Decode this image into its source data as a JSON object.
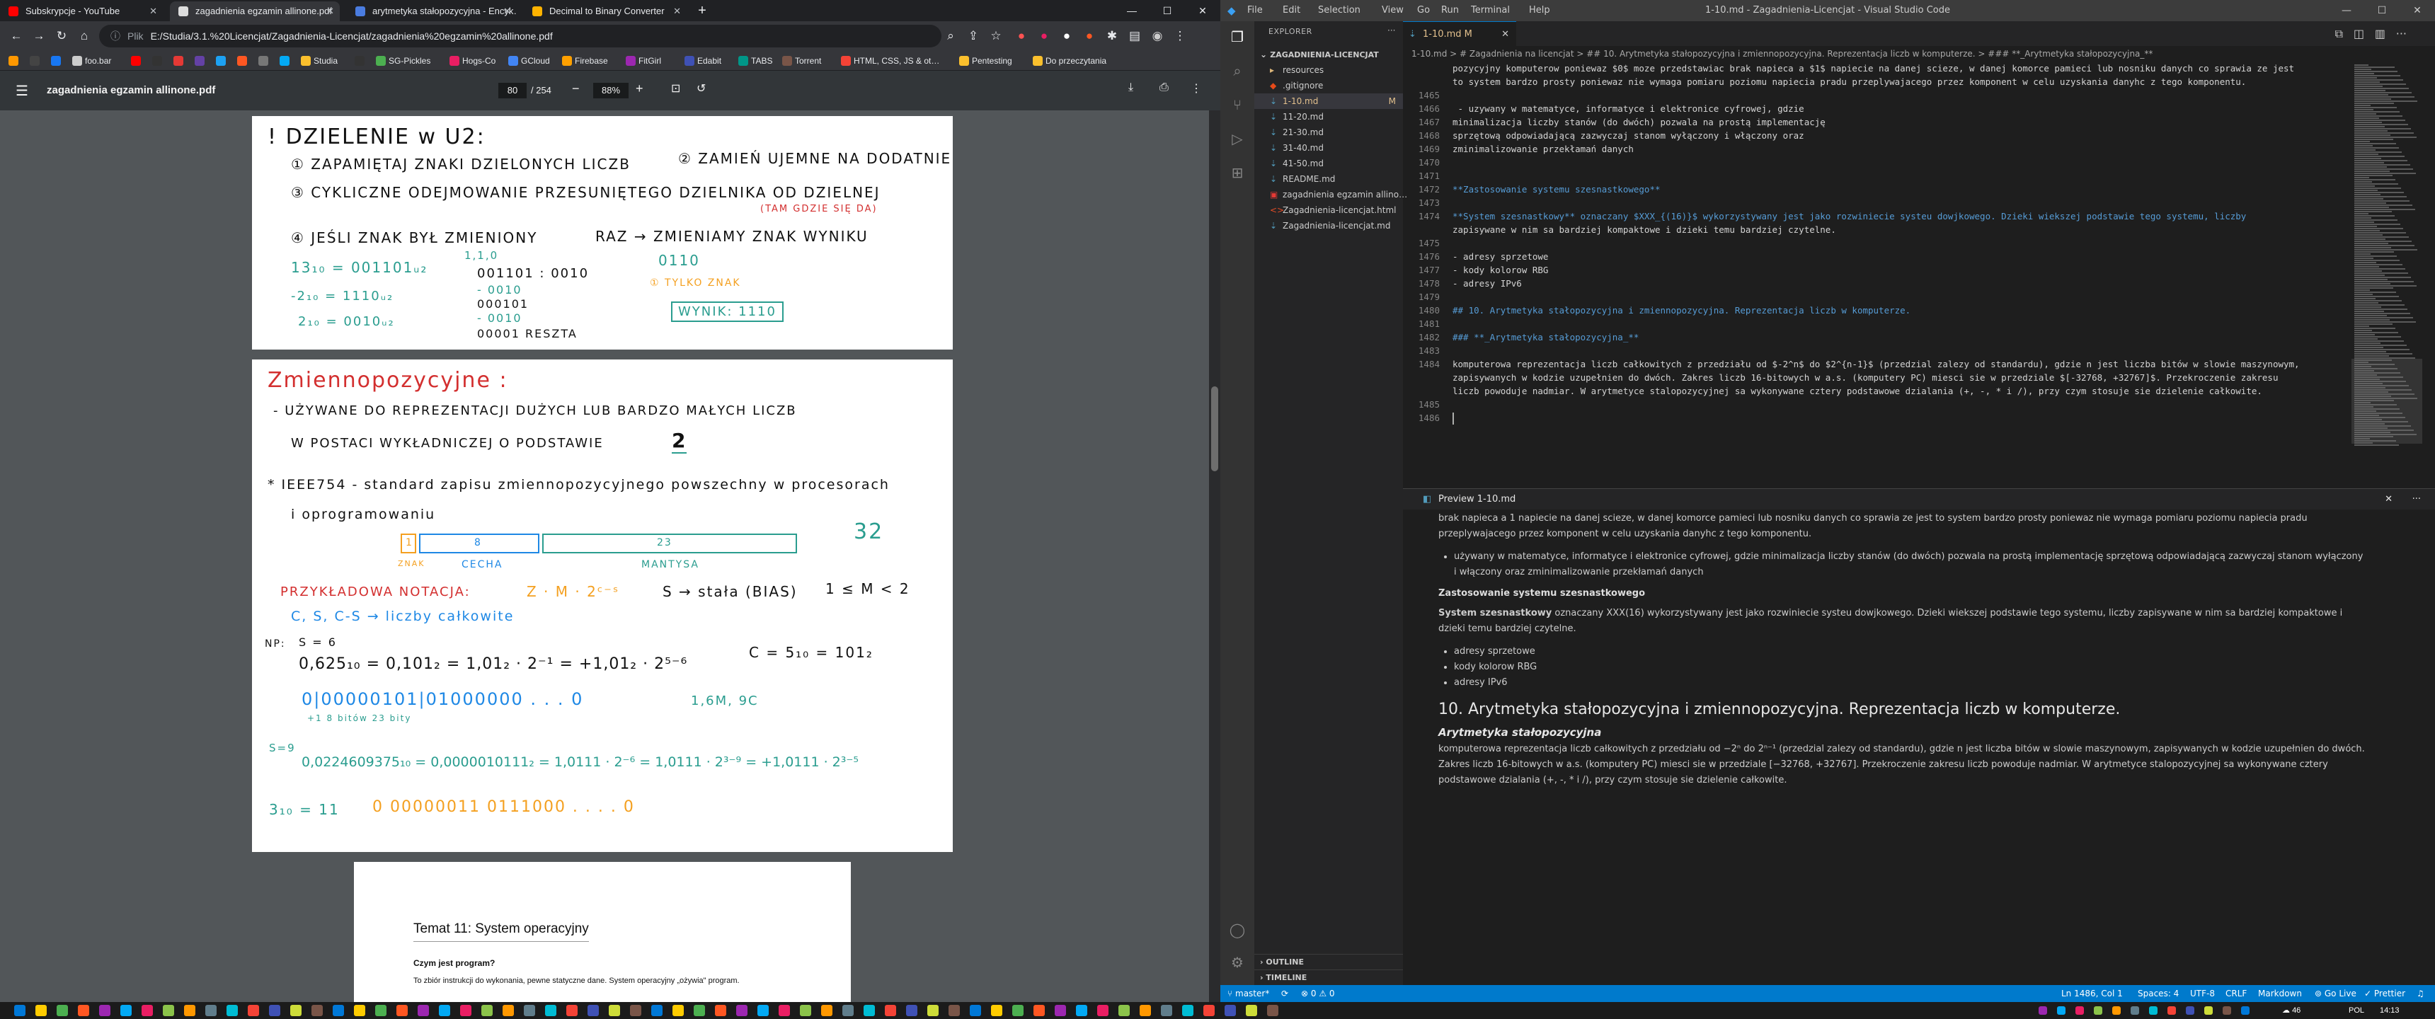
{
  "browser": {
    "tabs": [
      {
        "title": "Subskrypcje - YouTube",
        "color": "#ff0000"
      },
      {
        "title": "zagadnienia egzamin allinone.pdf",
        "color": "#dddddd"
      },
      {
        "title": "arytmetyka stałopozycyjna - Encyk…",
        "color": "#4a7ce0"
      },
      {
        "title": "Decimal to Binary Converter",
        "color": "#ffb300"
      }
    ],
    "newtab": "+",
    "url_label": "Plik",
    "url": "E:/Studia/3.1.%20Licencjat/Zagadnienia-Licencjat/zagadnienia%20egzamin%20allinone.pdf",
    "bookmarks": [
      {
        "label": "",
        "color": "#ff9800"
      },
      {
        "label": "",
        "color": "#444"
      },
      {
        "label": "",
        "color": "#1877f2"
      },
      {
        "label": "foo.bar",
        "color": "#cccccc"
      },
      {
        "label": "",
        "color": "#ff0000"
      },
      {
        "label": "",
        "color": "#333"
      },
      {
        "label": "",
        "color": "#e53935"
      },
      {
        "label": "",
        "color": "#6441a5"
      },
      {
        "label": "",
        "color": "#1da1f2"
      },
      {
        "label": "",
        "color": "#ff5722"
      },
      {
        "label": "",
        "color": "#777"
      },
      {
        "label": "",
        "color": "#03a9f4"
      },
      {
        "label": "Studia",
        "color": "#fbc02d"
      },
      {
        "label": "",
        "color": "#333"
      },
      {
        "label": "SG-Pickles",
        "color": "#4caf50"
      },
      {
        "label": "Hogs-Co",
        "color": "#e91e63"
      },
      {
        "label": "GCloud",
        "color": "#4285f4"
      },
      {
        "label": "Firebase",
        "color": "#ffa000"
      },
      {
        "label": "FitGirl",
        "color": "#9c27b0"
      },
      {
        "label": "Edabit",
        "color": "#3f51b5"
      },
      {
        "label": "TABS",
        "color": "#009688"
      },
      {
        "label": "Torrent",
        "color": "#795548"
      },
      {
        "label": "HTML, CSS, JS & ot…",
        "color": "#f44336"
      },
      {
        "label": "Pentesting",
        "color": "#fbc02d"
      },
      {
        "label": "Do przeczytania",
        "color": "#fbc02d"
      }
    ],
    "pdf": {
      "title": "zagadnienia egzamin allinone.pdf",
      "page": "80",
      "page_total": "/ 254",
      "zoom": "88%",
      "next_heading": "Temat 11: System operacyjny",
      "next_q": "Czym jest program?",
      "next_a": "To zbiór instrukcji do wykonania, pewne statyczne dane. System operacyjny „ożywia\" program."
    },
    "hand": {
      "h1": "! DZIELENIE w U2:",
      "s1": "① ZAPAMIĘTAJ ZNAKI DZIELONYCH LICZB",
      "s2": "② ZAMIEŃ UJEMNE NA DODATNIE",
      "s3": "③ CYKLICZNE ODEJMOWANIE PRZESUNIĘTEGO DZIELNIKA OD DZIELNEJ",
      "s3b": "(TAM GDZIE SIĘ DA)",
      "s4": "④ JEŚLI ZNAK BYŁ ZMIENIONY",
      "s4b": "RAZ → ZMIENIAMY ZNAK WYNIKU",
      "e1": "13₁₀ = 001101ᵤ₂",
      "e2": "-2₁₀ = 1110ᵤ₂",
      "e3": "2₁₀ = 0010ᵤ₂",
      "d1": "1,1,0",
      "d2": "001101 : 0010",
      "d3": "- 0010",
      "d4": "000101",
      "d5": "- 0010",
      "d6": "00001 RESZTA",
      "d7": "0110",
      "d8": "① TYLKO ZNAK",
      "d9": "WYNIK: 1110",
      "h2": "Zmiennopozycyjne :",
      "z1": "- UŻYWANE DO REPREZENTACJI DUŻYCH LUB BARDZO MAŁYCH LICZB",
      "z2": "W POSTACI WYKŁADNICZEJ O PODSTAWIE",
      "z2b": "2",
      "z3": "* IEEE754 - standard zapisu zmiennopozycyjnego powszechny w procesorach",
      "z4": "i oprogramowaniu",
      "z5": "1",
      "z6": "8",
      "z7": "23",
      "z8": "32",
      "z9": "ZNAK",
      "z10": "CECHA",
      "z11": "MANTYSA",
      "z12": "PRZYKŁADOWA NOTACJA:",
      "z13": "Z · M · 2ᶜ⁻ˢ",
      "z14": "S → stała (BIAS)",
      "z15": "1 ≤ M < 2",
      "z16": "C, S, C-S → liczby całkowite",
      "z17": "NP:",
      "z18": "S = 6",
      "z19": "0,625₁₀ = 0,101₂ = 1,01₂ · 2⁻¹ = +1,01₂ · 2⁵⁻⁶",
      "z20": "C = 5₁₀ = 101₂",
      "z21": "0|00000101|01000000 . . . 0",
      "z22": "+1   8 bitów          23 bity",
      "z23": "1,6M, 9C",
      "z24": "S=9",
      "z25": "0,0224609375₁₀ = 0,0000010111₂ = 1,0111 · 2⁻⁶ = 1,0111 · 2³⁻⁹ = +1,0111 · 2³⁻⁵",
      "z26": "3₁₀ = 11",
      "z27": "0 00000011 0111000 . . . . 0"
    }
  },
  "vscode": {
    "menu": [
      "File",
      "Edit",
      "Selection",
      "View",
      "Go",
      "Run",
      "Terminal",
      "Help"
    ],
    "window_title": "1-10.md - Zagadnienia-Licencjat - Visual Studio Code",
    "explorer_label": "EXPLORER",
    "folder": "ZAGADNIENIA-LICENCJAT",
    "tree": [
      {
        "label": "resources",
        "icon": "folder",
        "indent": 1,
        "sel": false,
        "badge": ""
      },
      {
        "label": ".gitignore",
        "icon": "git",
        "indent": 1,
        "sel": false,
        "badge": ""
      },
      {
        "label": "1-10.md",
        "icon": "md",
        "indent": 1,
        "sel": true,
        "badge": "M"
      },
      {
        "label": "11-20.md",
        "icon": "md",
        "indent": 1,
        "sel": false,
        "badge": ""
      },
      {
        "label": "21-30.md",
        "icon": "md",
        "indent": 1,
        "sel": false,
        "badge": ""
      },
      {
        "label": "31-40.md",
        "icon": "md",
        "indent": 1,
        "sel": false,
        "badge": ""
      },
      {
        "label": "41-50.md",
        "icon": "md",
        "indent": 1,
        "sel": false,
        "badge": ""
      },
      {
        "label": "README.md",
        "icon": "md",
        "indent": 1,
        "sel": false,
        "badge": ""
      },
      {
        "label": "zagadnienia egzamin allino…",
        "icon": "pdf",
        "indent": 1,
        "sel": false,
        "badge": ""
      },
      {
        "label": "Zagadnienia-licencjat.html",
        "icon": "html",
        "indent": 1,
        "sel": false,
        "badge": ""
      },
      {
        "label": "Zagadnienia-licencjat.md",
        "icon": "md",
        "indent": 1,
        "sel": false,
        "badge": ""
      }
    ],
    "outline": "OUTLINE",
    "timeline": "TIMELINE",
    "editor_tab": "1-10.md M",
    "breadcrumb": "1-10.md > # Zagadnienia na licencjat > ## 10. Arytmetyka stałopozycyjna i zmiennopozycyjna. Reprezentacja liczb w komputerze. > ### **_Arytmetyka stałopozycyjna_**",
    "code_lines": [
      {
        "n": "",
        "t": "pozycyjny komputerow poniewaz $0$ moze przedstawiac brak napieca a $1$ napiecie na danej scieze, w danej komorce pamieci lub nosniku danych co sprawia ze jest"
      },
      {
        "n": "",
        "t": "to system bardzo prosty poniewaz nie wymaga pomiaru poziomu napiecia pradu przeplywajacego przez komponent w celu uzyskania danyhc z tego komponentu."
      },
      {
        "n": "1465",
        "t": ""
      },
      {
        "n": "1466",
        "t": " - uzywany w matematyce, informatyce i elektronice cyfrowej, gdzie"
      },
      {
        "n": "1467",
        "t": "minimalizacja liczby stanów (do dwóch) pozwala na prostą implementację"
      },
      {
        "n": "1468",
        "t": "sprzętową odpowiadającą zazwyczaj stanom wyłączony i włączony oraz"
      },
      {
        "n": "1469",
        "t": "zminimalizowanie przekłamań danych"
      },
      {
        "n": "1470",
        "t": ""
      },
      {
        "n": "1471",
        "t": ""
      },
      {
        "n": "1472",
        "t": "**Zastosowanie systemu szesnastkowego**"
      },
      {
        "n": "1473",
        "t": ""
      },
      {
        "n": "1474",
        "t": "**System szesnastkowy** oznaczany $XXX_{(16)}$ wykorzystywany jest jako rozwiniecie systeu dowjkowego. Dzieki wiekszej podstawie tego systemu, liczby"
      },
      {
        "n": "",
        "t": "zapisywane w nim sa bardziej kompaktowe i dzieki temu bardziej czytelne."
      },
      {
        "n": "1475",
        "t": ""
      },
      {
        "n": "1476",
        "t": "- adresy sprzetowe"
      },
      {
        "n": "1477",
        "t": "- kody kolorow RBG"
      },
      {
        "n": "1478",
        "t": "- adresy IPv6"
      },
      {
        "n": "1479",
        "t": ""
      },
      {
        "n": "1480",
        "t": "## 10. Arytmetyka stałopozycyjna i zmiennopozycyjna. Reprezentacja liczb w komputerze."
      },
      {
        "n": "1481",
        "t": ""
      },
      {
        "n": "1482",
        "t": "### **_Arytmetyka stałopozycyjna_**"
      },
      {
        "n": "1483",
        "t": ""
      },
      {
        "n": "1484",
        "t": "komputerowa reprezentacja liczb całkowitych z przedziału od $-2^n$ do $2^{n-1}$ (przedzial zalezy od standardu), gdzie n jest liczba bitów w slowie maszynowym,"
      },
      {
        "n": "",
        "t": "zapisywanych w kodzie uzupełnien do dwóch. Zakres liczb 16-bitowych w a.s. (komputery PC) miesci sie w przedziale $[-32768, +32767]$. Przekroczenie zakresu"
      },
      {
        "n": "",
        "t": "liczb powoduje nadmiar. W arytmetyce stalopozycyjnej sa wykonywane cztery podstawowe dzialania (+, -, * i /), przy czym stosuje sie dzielenie całkowite."
      },
      {
        "n": "1485",
        "t": ""
      },
      {
        "n": "1486",
        "t": ""
      }
    ],
    "preview_title": "Preview 1-10.md",
    "preview": {
      "p0": "brak napieca a 1 napiecie na danej scieze, w danej komorce pamieci lub nosniku danych co sprawia ze jest to system bardzo prosty poniewaz nie wymaga pomiaru poziomu napiecia pradu przeplywajacego przez komponent w celu uzyskania danyhc z tego komponentu.",
      "li0": "używany w matematyce, informatyce i elektronice cyfrowej, gdzie minimalizacja liczby stanów (do dwóch) pozwala na prostą implementację sprzętową odpowiadającą zazwyczaj stanom wyłączony i włączony oraz zminimalizowanie przekłamań danych",
      "h_zast": "Zastosowanie systemu szesnastkowego",
      "p1_bold": "System szesnastkowy",
      "p1": "oznaczany XXX(16) wykorzystywany jest jako rozwiniecie systeu dowjkowego. Dzieki wiekszej podstawie tego systemu, liczby zapisywane w nim sa bardziej kompaktowe i dzieki temu bardziej czytelne.",
      "li1": "adresy sprzetowe",
      "li2": "kody kolorow RBG",
      "li3": "adresy IPv6",
      "h2": "10. Arytmetyka stałopozycyjna i zmiennopozycyjna. Reprezentacja liczb w komputerze.",
      "h3": "Arytmetyka stałopozycyjna",
      "p2": "komputerowa reprezentacja liczb całkowitych z przedziału od −2ⁿ do 2ⁿ⁻¹ (przedzial zalezy od standardu), gdzie n jest liczba bitów w slowie maszynowym, zapisywanych w kodzie uzupełnien do dwóch. Zakres liczb 16-bitowych w a.s. (komputery PC) miesci sie w przedziale [−32768, +32767]. Przekroczenie zakresu liczb powoduje nadmiar. W arytmetyce stalopozycyjnej sa wykonywane cztery podstawowe dzialania (+, -, * i /), przy czym stosuje sie dzielenie całkowite."
    },
    "status": {
      "branch": "master*",
      "sync": "⟳",
      "errors": "⊗ 0 ⚠ 0",
      "cursor": "Ln 1486, Col 1",
      "spaces": "Spaces: 4",
      "encoding": "UTF-8",
      "eol": "CRLF",
      "lang": "Markdown",
      "golive": "Go Live",
      "prettier": "✓ Prettier"
    }
  },
  "taskbar": {
    "lang": "POL",
    "time": "14:13",
    "temp": "46"
  }
}
